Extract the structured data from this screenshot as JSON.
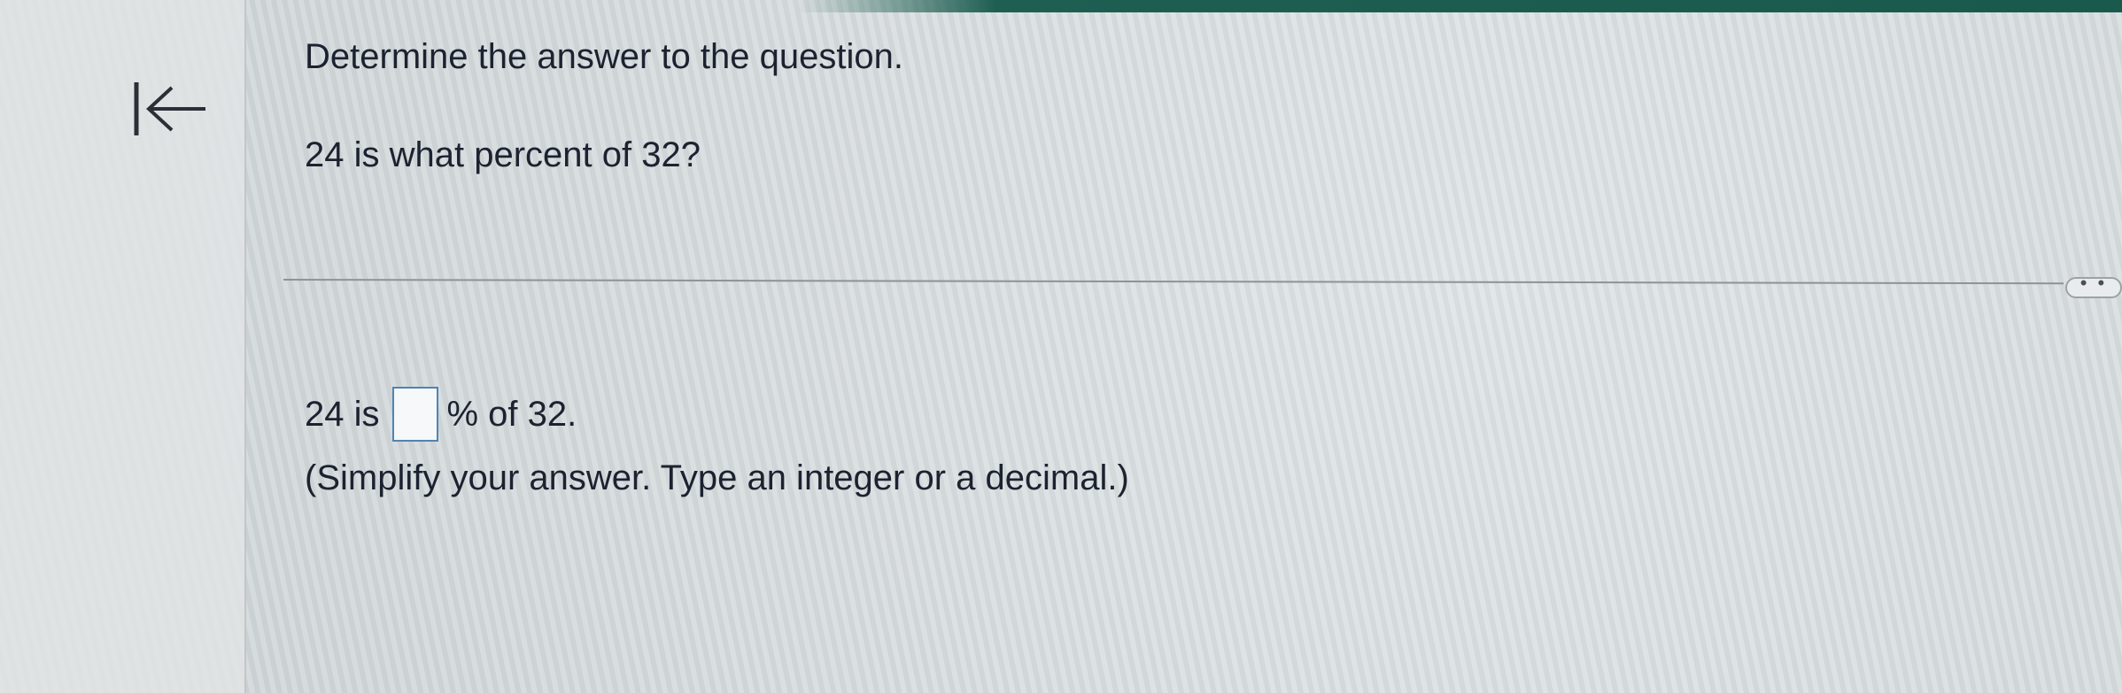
{
  "question": {
    "instruction": "Determine the answer to the question.",
    "prompt": "24 is what percent of 32?"
  },
  "answer": {
    "prefix": "24 is",
    "input_value": "",
    "suffix": "% of 32.",
    "hint": "(Simplify your answer. Type an integer or a decimal.)"
  },
  "toolbar": {
    "more_label": "• •"
  },
  "icons": {
    "back": "arrow-left-to-bar-icon"
  },
  "colors": {
    "accent": "#1a5a4c",
    "input_border": "#4f84b3"
  }
}
